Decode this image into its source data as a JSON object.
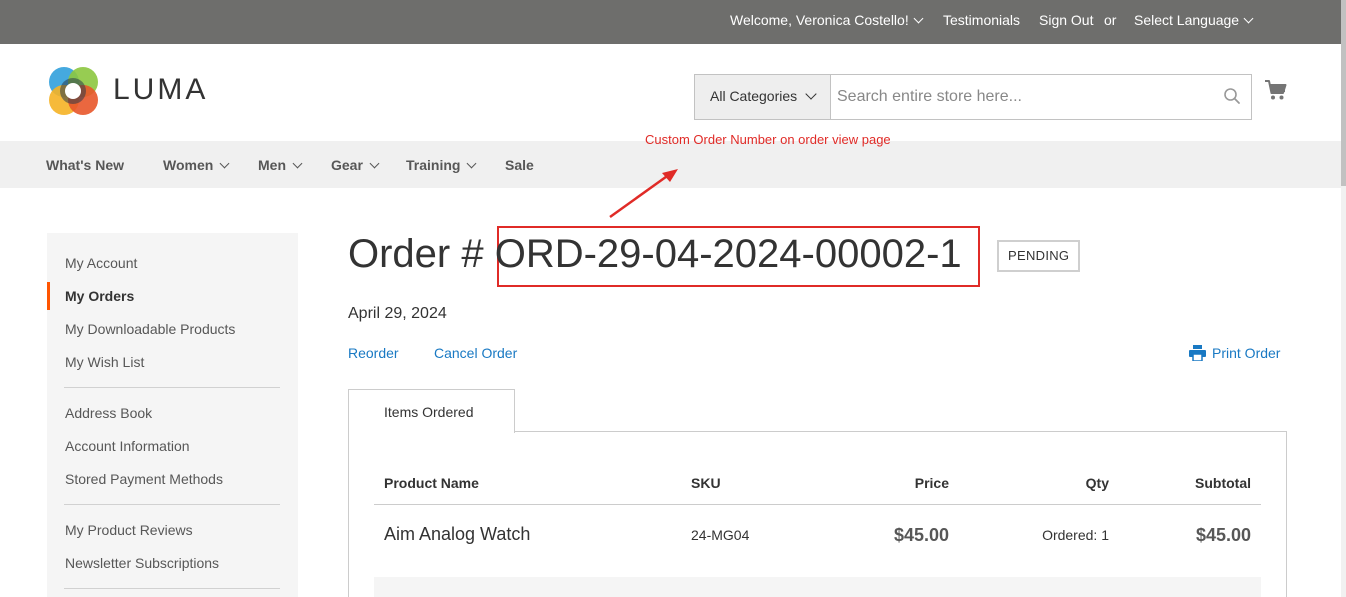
{
  "topbar": {
    "welcome": "Welcome, Veronica Costello!",
    "testimonials": "Testimonials",
    "sign_out": "Sign Out",
    "or": "or",
    "language": "Select Language"
  },
  "header": {
    "logo_text": "LUMA",
    "category_select": "All Categories",
    "search_placeholder": "Search entire store here..."
  },
  "nav": {
    "items": [
      "What's New",
      "Women",
      "Men",
      "Gear",
      "Training",
      "Sale"
    ]
  },
  "annotation": {
    "label": "Custom Order Number on order view page",
    "color": "#e02b27"
  },
  "sidebar": {
    "items": [
      "My Account",
      "My Orders",
      "My Downloadable Products",
      "My Wish List",
      "Address Book",
      "Account Information",
      "Stored Payment Methods",
      "My Product Reviews",
      "Newsletter Subscriptions"
    ],
    "active": "My Orders",
    "accent_color": "#ff5501"
  },
  "order": {
    "title_prefix": "Order # ",
    "number": "ORD-29-04-2024-00002-1",
    "status": "Pending",
    "date": "April 29, 2024",
    "reorder": "Reorder",
    "cancel": "Cancel Order",
    "print": "Print Order"
  },
  "tabs": {
    "items_ordered": "Items Ordered"
  },
  "table": {
    "headers": [
      "Product Name",
      "SKU",
      "Price",
      "Qty",
      "Subtotal"
    ],
    "rows": [
      {
        "name": "Aim Analog Watch",
        "sku": "24-MG04",
        "price": "$45.00",
        "qty": "Ordered: 1",
        "subtotal": "$45.00"
      }
    ]
  },
  "colors": {
    "link": "#1979c3",
    "topbar_bg": "#6e6e6c",
    "nav_bg": "#f0f0f0"
  }
}
